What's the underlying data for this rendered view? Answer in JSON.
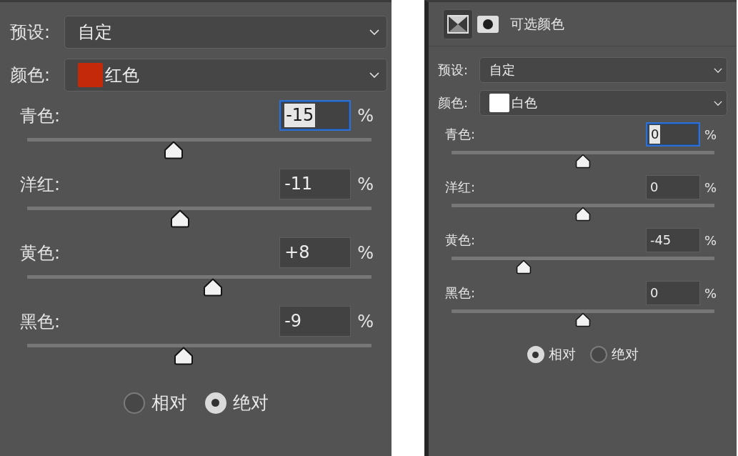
{
  "panels": [
    {
      "preset": {
        "label": "预设:",
        "value": "自定"
      },
      "color_select": {
        "label": "颜色:",
        "value": "红色",
        "color": "#c4290a"
      },
      "channels": [
        {
          "name": "青色:",
          "value": "-15",
          "unit": "%",
          "focused": true,
          "level": 0.425
        },
        {
          "name": "洋红:",
          "value": "-11",
          "unit": "%",
          "focused": false,
          "level": 0.445
        },
        {
          "name": "黄色:",
          "value": "+8",
          "unit": "%",
          "focused": false,
          "level": 0.54
        },
        {
          "name": "黑色:",
          "value": "-9",
          "unit": "%",
          "focused": false,
          "level": 0.455
        }
      ],
      "methods": [
        {
          "label": "相对",
          "selected": false
        },
        {
          "label": "绝对",
          "selected": true
        }
      ]
    },
    {
      "header": {
        "buttons": [
          {
            "kind": "adjustment",
            "selected": true
          },
          {
            "kind": "mask",
            "selected": false
          }
        ],
        "title": "可选颜色"
      },
      "preset": {
        "label": "预设:",
        "value": "自定"
      },
      "color_select": {
        "label": "颜色:",
        "value": "白色",
        "color": "#ffffff"
      },
      "channels": [
        {
          "name": "青色:",
          "value": "0",
          "unit": "%",
          "focused": true,
          "level": 0.5
        },
        {
          "name": "洋红:",
          "value": "0",
          "unit": "%",
          "focused": false,
          "level": 0.5
        },
        {
          "name": "黄色:",
          "value": "-45",
          "unit": "%",
          "focused": false,
          "level": 0.275
        },
        {
          "name": "黑色:",
          "value": "0",
          "unit": "%",
          "focused": false,
          "level": 0.5
        }
      ],
      "methods": [
        {
          "label": "相对",
          "selected": true
        },
        {
          "label": "绝对",
          "selected": false
        }
      ]
    }
  ]
}
